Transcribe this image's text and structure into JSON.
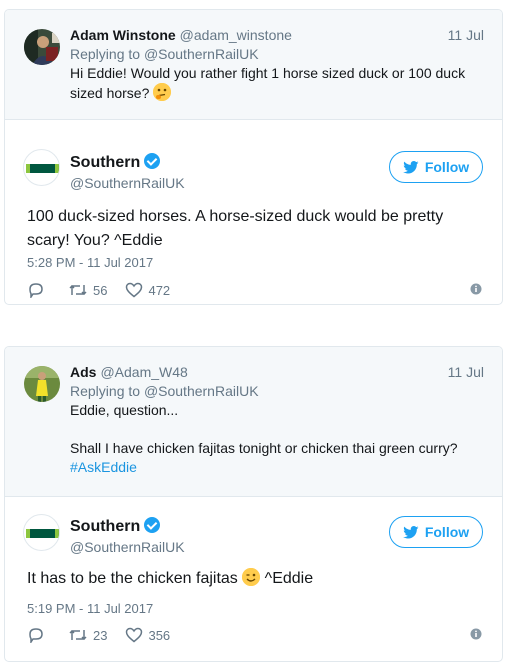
{
  "tweets": [
    {
      "parent": {
        "name": "Adam Winstone",
        "handle": "@adam_winstone",
        "date": "11 Jul",
        "replying_prefix": "Replying to ",
        "replying_to": "@SouthernRailUK",
        "text": "Hi Eddie! Would you rather fight 1 horse sized duck or 100 duck sized horse? ",
        "emoji": "thinking-face-emoji"
      },
      "reply": {
        "name": "Southern",
        "handle": "@SouthernRailUK",
        "follow_label": "Follow",
        "text": "100 duck-sized horses. A horse-sized duck would be pretty scary! You? ^Eddie",
        "timestamp": "5:28 PM - 11 Jul 2017",
        "retweets": "56",
        "likes": "472"
      }
    },
    {
      "parent": {
        "name": "Ads",
        "handle": "@Adam_W48",
        "date": "11 Jul",
        "replying_prefix": "Replying to ",
        "replying_to": "@SouthernRailUK",
        "text_line1": "Eddie, question...",
        "text_line2": "Shall I have chicken fajitas tonight or chicken thai green curry?",
        "hashtag": "#AskEddie"
      },
      "reply": {
        "name": "Southern",
        "handle": "@SouthernRailUK",
        "follow_label": "Follow",
        "text_before": "It has to be the chicken fajitas ",
        "emoji": "winking-face-emoji",
        "text_after": " ^Eddie",
        "timestamp": "5:19 PM - 11 Jul 2017",
        "retweets": "23",
        "likes": "356"
      }
    }
  ],
  "logo_text": "SOUTHERN",
  "colors": {
    "accent": "#1da1f2",
    "muted": "#657786",
    "hashtag": "#1b95e0",
    "southern_green": "#00573f"
  }
}
